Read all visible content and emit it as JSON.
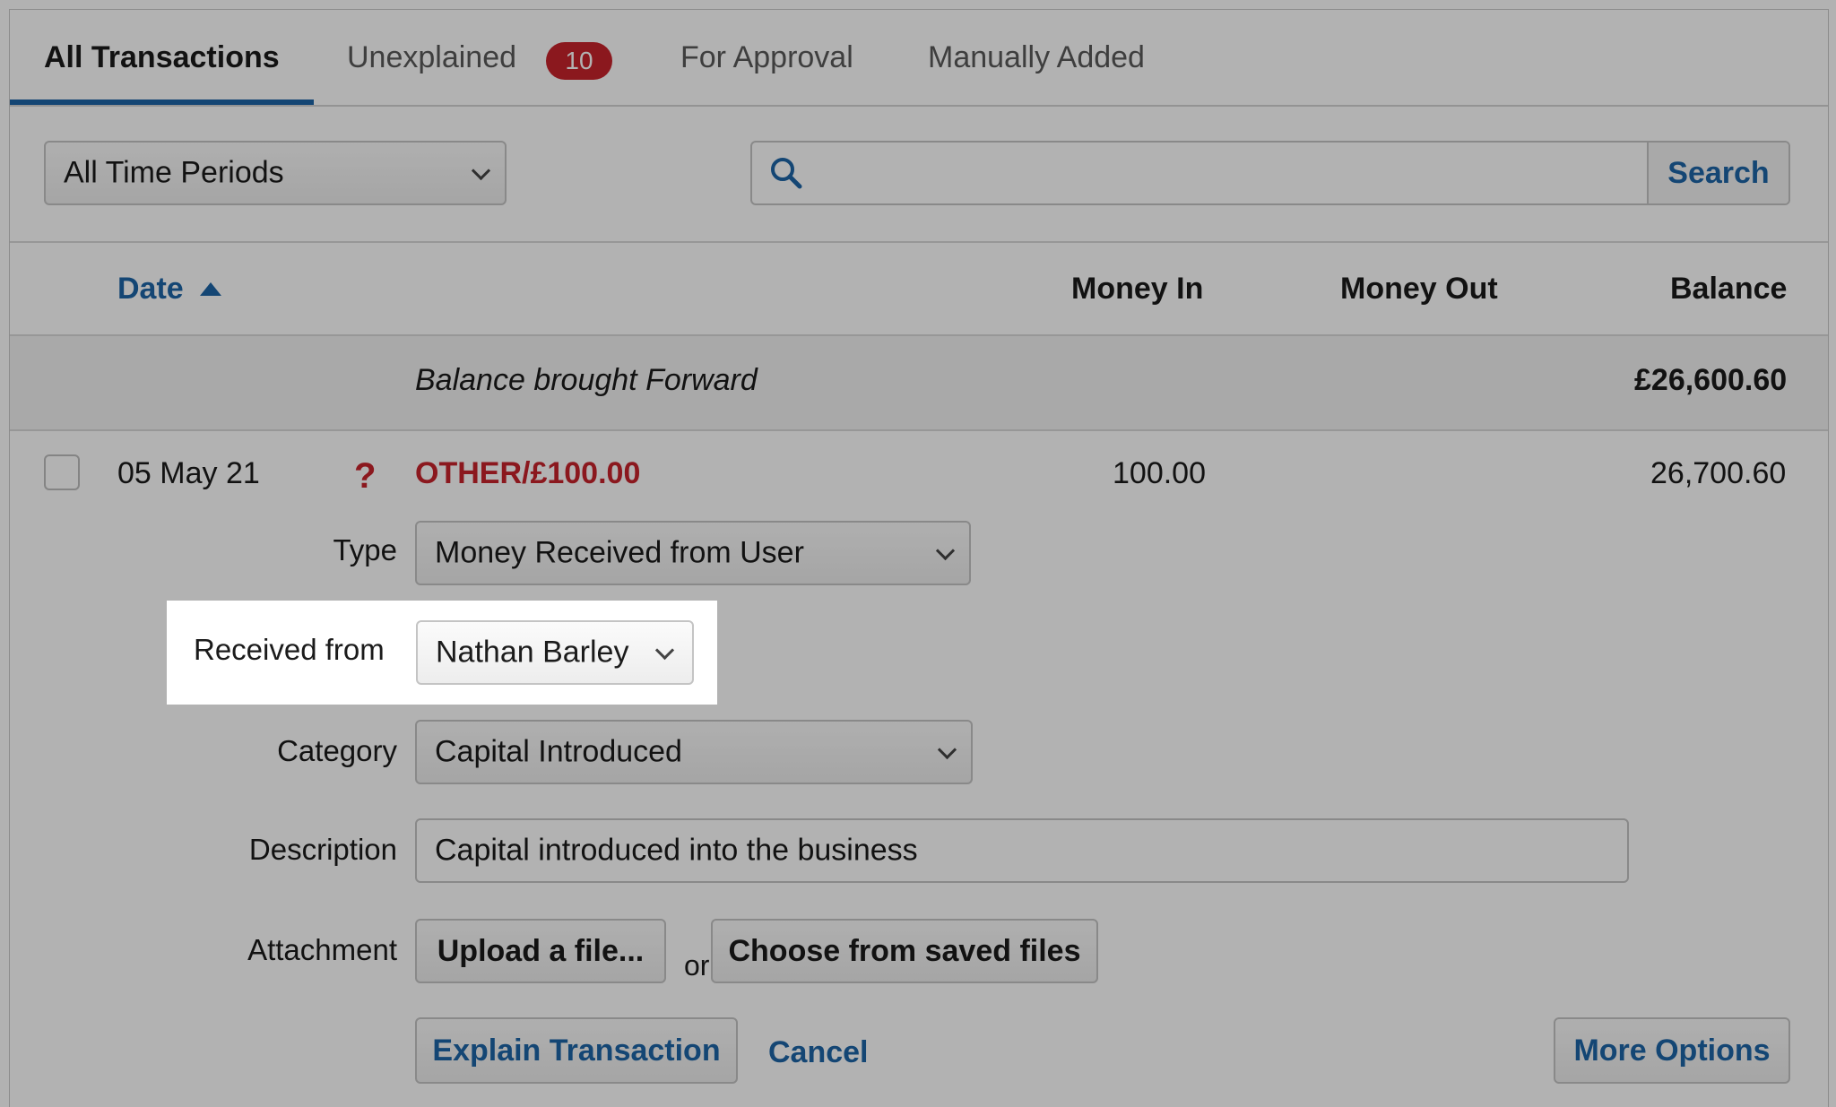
{
  "tabs": [
    {
      "label": "All Transactions",
      "active": true
    },
    {
      "label": "Unexplained",
      "badge": "10"
    },
    {
      "label": "For Approval"
    },
    {
      "label": "Manually Added"
    }
  ],
  "filters": {
    "period": "All Time Periods",
    "search_value": "",
    "search_button": "Search"
  },
  "table": {
    "columns": {
      "date": "Date",
      "money_in": "Money In",
      "money_out": "Money Out",
      "balance": "Balance"
    },
    "bbf": {
      "label": "Balance brought Forward",
      "balance": "£26,600.60"
    },
    "transaction": {
      "date": "05 May 21",
      "status_icon": "?",
      "description": "OTHER/£100.00",
      "money_in": "100.00",
      "money_out": "",
      "balance": "26,700.60"
    }
  },
  "form": {
    "type_label": "Type",
    "type_value": "Money Received from User",
    "received_from_label": "Received from",
    "received_from_value": "Nathan Barley",
    "category_label": "Category",
    "category_value": "Capital Introduced",
    "description_label": "Description",
    "description_value": "Capital introduced into the business",
    "attachment_label": "Attachment",
    "upload_button": "Upload a file...",
    "or_text": "or",
    "choose_button": "Choose from saved files",
    "explain_button": "Explain Transaction",
    "cancel_link": "Cancel",
    "more_options_button": "More Options"
  },
  "colors": {
    "accent": "#1d65a6",
    "alert": "#c8232b",
    "overlay": "rgba(0,0,0,0.3)"
  }
}
